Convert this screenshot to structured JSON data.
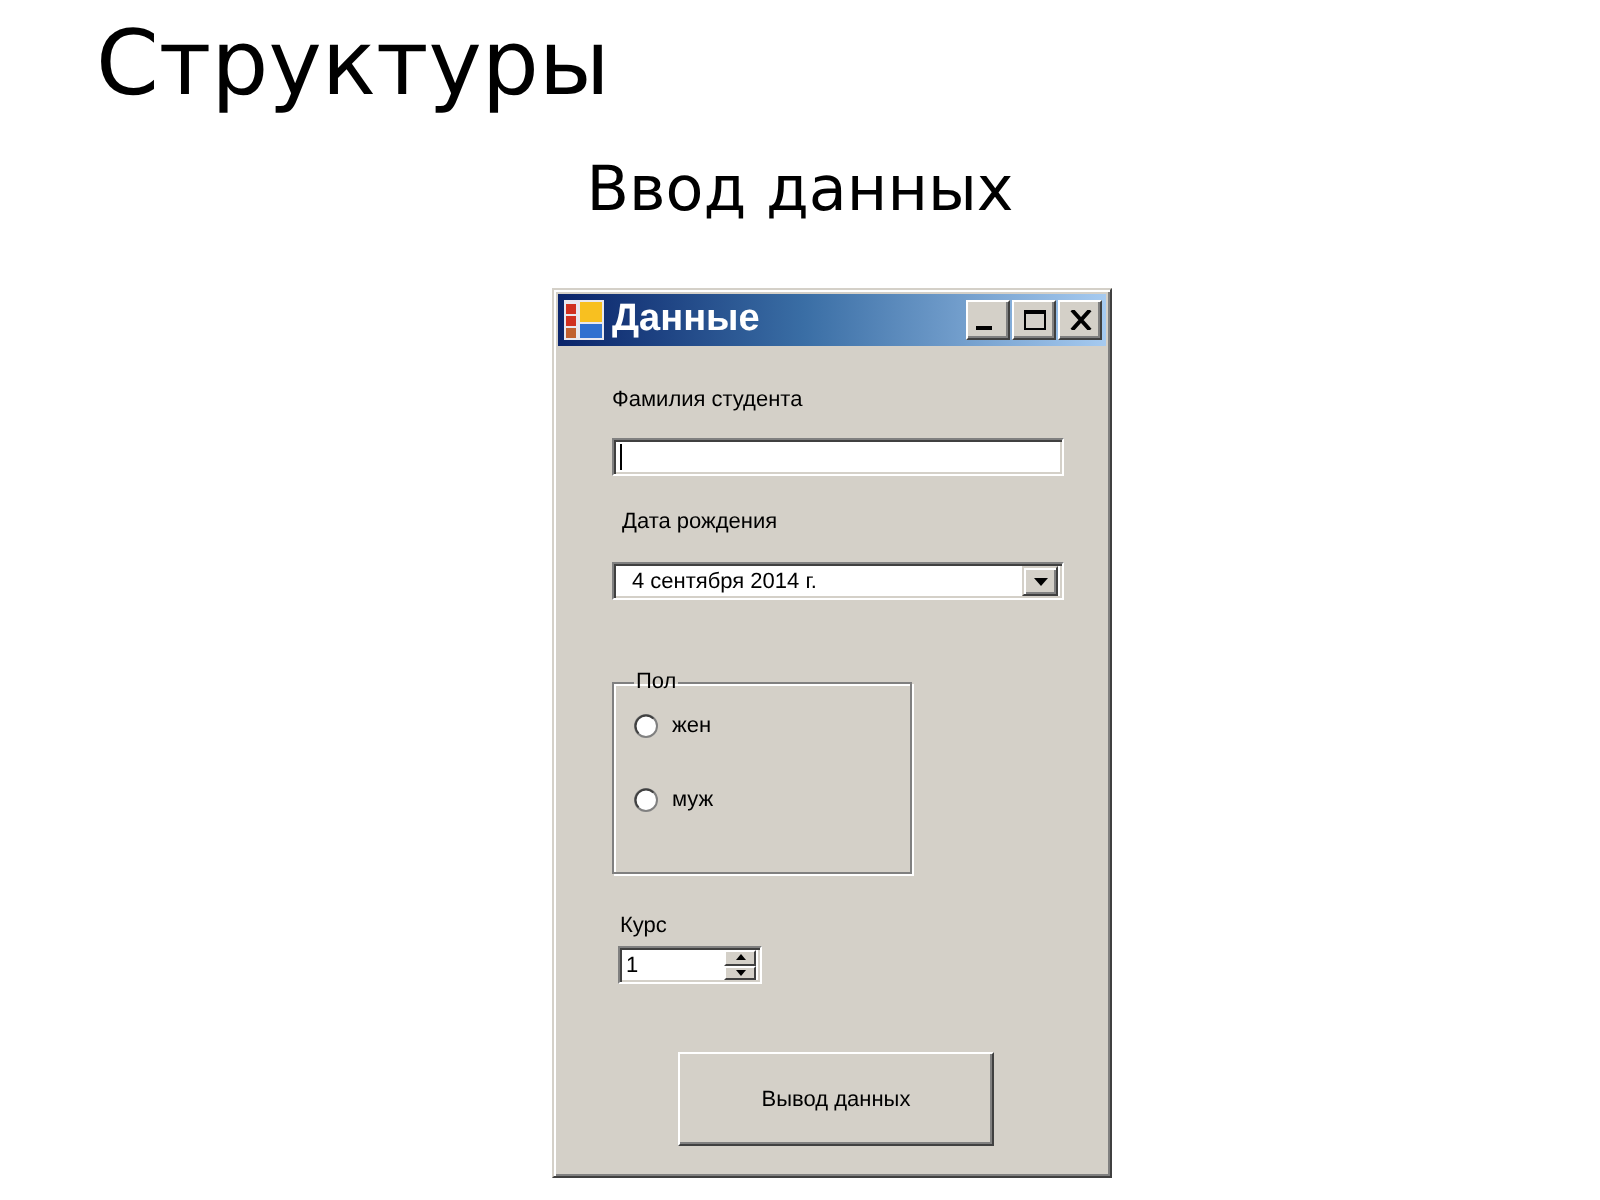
{
  "slide": {
    "title": "Структуры",
    "subtitle": "Ввод данных"
  },
  "window": {
    "title": "Данные"
  },
  "form": {
    "surname": {
      "label": "Фамилия студента",
      "focused": true
    },
    "birth_date": {
      "label": "Дата рождения",
      "value": "4 сентября 2014 г."
    },
    "gender": {
      "legend": "Пол",
      "options": [
        {
          "label": "жен",
          "selected": false
        },
        {
          "label": "муж",
          "selected": false
        }
      ]
    },
    "course": {
      "label": "Курс",
      "value": "1"
    },
    "submit_button": {
      "label": "Вывод данных"
    }
  }
}
